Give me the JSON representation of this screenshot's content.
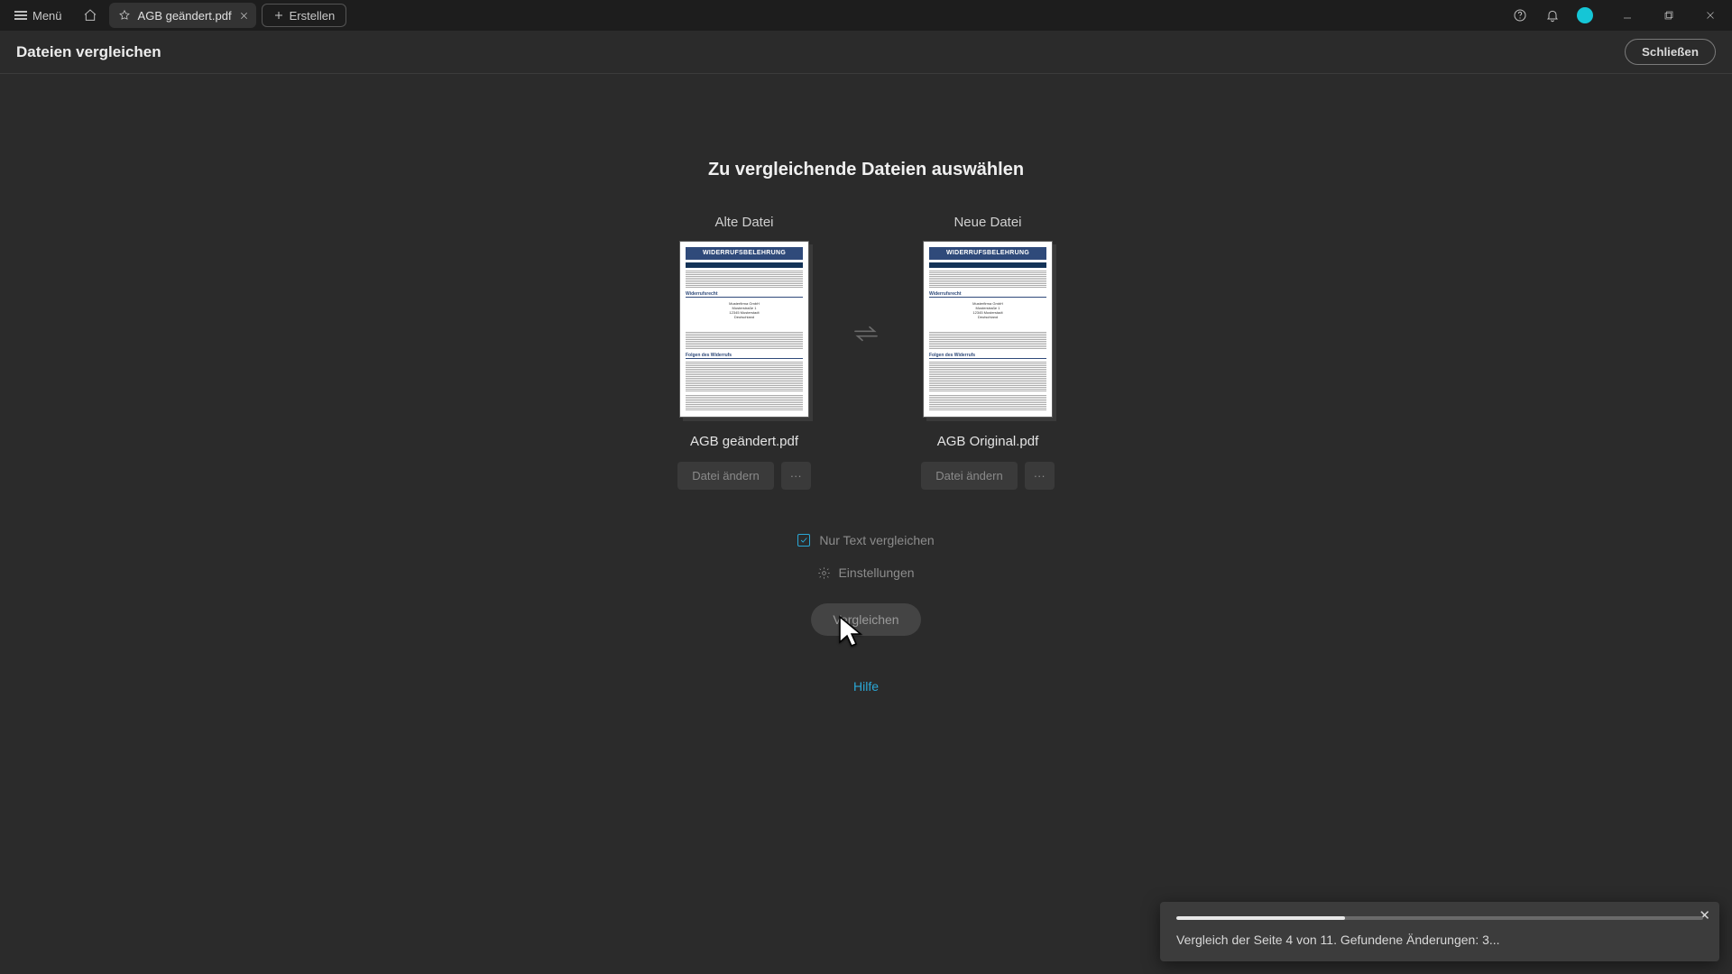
{
  "titlebar": {
    "menu_label": "Menü",
    "tab": {
      "title": "AGB geändert.pdf"
    },
    "create_label": "Erstellen"
  },
  "toolheader": {
    "title": "Dateien vergleichen",
    "close_label": "Schließen"
  },
  "compare": {
    "heading": "Zu vergleichende Dateien auswählen",
    "old": {
      "label": "Alte Datei",
      "filename": "AGB geändert.pdf",
      "change_label": "Datei ändern",
      "more_label": "···",
      "thumb_title": "WIDERRUFSBELEHRUNG"
    },
    "new": {
      "label": "Neue Datei",
      "filename": "AGB Original.pdf",
      "change_label": "Datei ändern",
      "more_label": "···",
      "thumb_title": "WIDERRUFSBELEHRUNG"
    },
    "only_text_label": "Nur Text vergleichen",
    "only_text_checked": true,
    "settings_label": "Einstellungen",
    "compare_button": "Vergleichen",
    "help_label": "Hilfe"
  },
  "toast": {
    "message": "Vergleich der Seite 4 von 11. Gefundene Änderungen: 3...",
    "progress_percent": 32
  }
}
